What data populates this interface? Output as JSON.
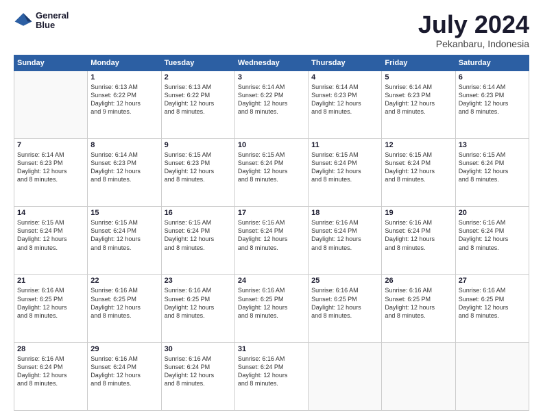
{
  "header": {
    "logo_line1": "General",
    "logo_line2": "Blue",
    "main_title": "July 2024",
    "subtitle": "Pekanbaru, Indonesia"
  },
  "calendar": {
    "days_of_week": [
      "Sunday",
      "Monday",
      "Tuesday",
      "Wednesday",
      "Thursday",
      "Friday",
      "Saturday"
    ],
    "weeks": [
      [
        {
          "day": "",
          "info": ""
        },
        {
          "day": "1",
          "info": "Sunrise: 6:13 AM\nSunset: 6:22 PM\nDaylight: 12 hours\nand 9 minutes."
        },
        {
          "day": "2",
          "info": "Sunrise: 6:13 AM\nSunset: 6:22 PM\nDaylight: 12 hours\nand 8 minutes."
        },
        {
          "day": "3",
          "info": "Sunrise: 6:14 AM\nSunset: 6:22 PM\nDaylight: 12 hours\nand 8 minutes."
        },
        {
          "day": "4",
          "info": "Sunrise: 6:14 AM\nSunset: 6:23 PM\nDaylight: 12 hours\nand 8 minutes."
        },
        {
          "day": "5",
          "info": "Sunrise: 6:14 AM\nSunset: 6:23 PM\nDaylight: 12 hours\nand 8 minutes."
        },
        {
          "day": "6",
          "info": "Sunrise: 6:14 AM\nSunset: 6:23 PM\nDaylight: 12 hours\nand 8 minutes."
        }
      ],
      [
        {
          "day": "7",
          "info": "Sunrise: 6:14 AM\nSunset: 6:23 PM\nDaylight: 12 hours\nand 8 minutes."
        },
        {
          "day": "8",
          "info": "Sunrise: 6:14 AM\nSunset: 6:23 PM\nDaylight: 12 hours\nand 8 minutes."
        },
        {
          "day": "9",
          "info": "Sunrise: 6:15 AM\nSunset: 6:23 PM\nDaylight: 12 hours\nand 8 minutes."
        },
        {
          "day": "10",
          "info": "Sunrise: 6:15 AM\nSunset: 6:24 PM\nDaylight: 12 hours\nand 8 minutes."
        },
        {
          "day": "11",
          "info": "Sunrise: 6:15 AM\nSunset: 6:24 PM\nDaylight: 12 hours\nand 8 minutes."
        },
        {
          "day": "12",
          "info": "Sunrise: 6:15 AM\nSunset: 6:24 PM\nDaylight: 12 hours\nand 8 minutes."
        },
        {
          "day": "13",
          "info": "Sunrise: 6:15 AM\nSunset: 6:24 PM\nDaylight: 12 hours\nand 8 minutes."
        }
      ],
      [
        {
          "day": "14",
          "info": "Sunrise: 6:15 AM\nSunset: 6:24 PM\nDaylight: 12 hours\nand 8 minutes."
        },
        {
          "day": "15",
          "info": "Sunrise: 6:15 AM\nSunset: 6:24 PM\nDaylight: 12 hours\nand 8 minutes."
        },
        {
          "day": "16",
          "info": "Sunrise: 6:15 AM\nSunset: 6:24 PM\nDaylight: 12 hours\nand 8 minutes."
        },
        {
          "day": "17",
          "info": "Sunrise: 6:16 AM\nSunset: 6:24 PM\nDaylight: 12 hours\nand 8 minutes."
        },
        {
          "day": "18",
          "info": "Sunrise: 6:16 AM\nSunset: 6:24 PM\nDaylight: 12 hours\nand 8 minutes."
        },
        {
          "day": "19",
          "info": "Sunrise: 6:16 AM\nSunset: 6:24 PM\nDaylight: 12 hours\nand 8 minutes."
        },
        {
          "day": "20",
          "info": "Sunrise: 6:16 AM\nSunset: 6:24 PM\nDaylight: 12 hours\nand 8 minutes."
        }
      ],
      [
        {
          "day": "21",
          "info": "Sunrise: 6:16 AM\nSunset: 6:25 PM\nDaylight: 12 hours\nand 8 minutes."
        },
        {
          "day": "22",
          "info": "Sunrise: 6:16 AM\nSunset: 6:25 PM\nDaylight: 12 hours\nand 8 minutes."
        },
        {
          "day": "23",
          "info": "Sunrise: 6:16 AM\nSunset: 6:25 PM\nDaylight: 12 hours\nand 8 minutes."
        },
        {
          "day": "24",
          "info": "Sunrise: 6:16 AM\nSunset: 6:25 PM\nDaylight: 12 hours\nand 8 minutes."
        },
        {
          "day": "25",
          "info": "Sunrise: 6:16 AM\nSunset: 6:25 PM\nDaylight: 12 hours\nand 8 minutes."
        },
        {
          "day": "26",
          "info": "Sunrise: 6:16 AM\nSunset: 6:25 PM\nDaylight: 12 hours\nand 8 minutes."
        },
        {
          "day": "27",
          "info": "Sunrise: 6:16 AM\nSunset: 6:25 PM\nDaylight: 12 hours\nand 8 minutes."
        }
      ],
      [
        {
          "day": "28",
          "info": "Sunrise: 6:16 AM\nSunset: 6:24 PM\nDaylight: 12 hours\nand 8 minutes."
        },
        {
          "day": "29",
          "info": "Sunrise: 6:16 AM\nSunset: 6:24 PM\nDaylight: 12 hours\nand 8 minutes."
        },
        {
          "day": "30",
          "info": "Sunrise: 6:16 AM\nSunset: 6:24 PM\nDaylight: 12 hours\nand 8 minutes."
        },
        {
          "day": "31",
          "info": "Sunrise: 6:16 AM\nSunset: 6:24 PM\nDaylight: 12 hours\nand 8 minutes."
        },
        {
          "day": "",
          "info": ""
        },
        {
          "day": "",
          "info": ""
        },
        {
          "day": "",
          "info": ""
        }
      ]
    ]
  }
}
